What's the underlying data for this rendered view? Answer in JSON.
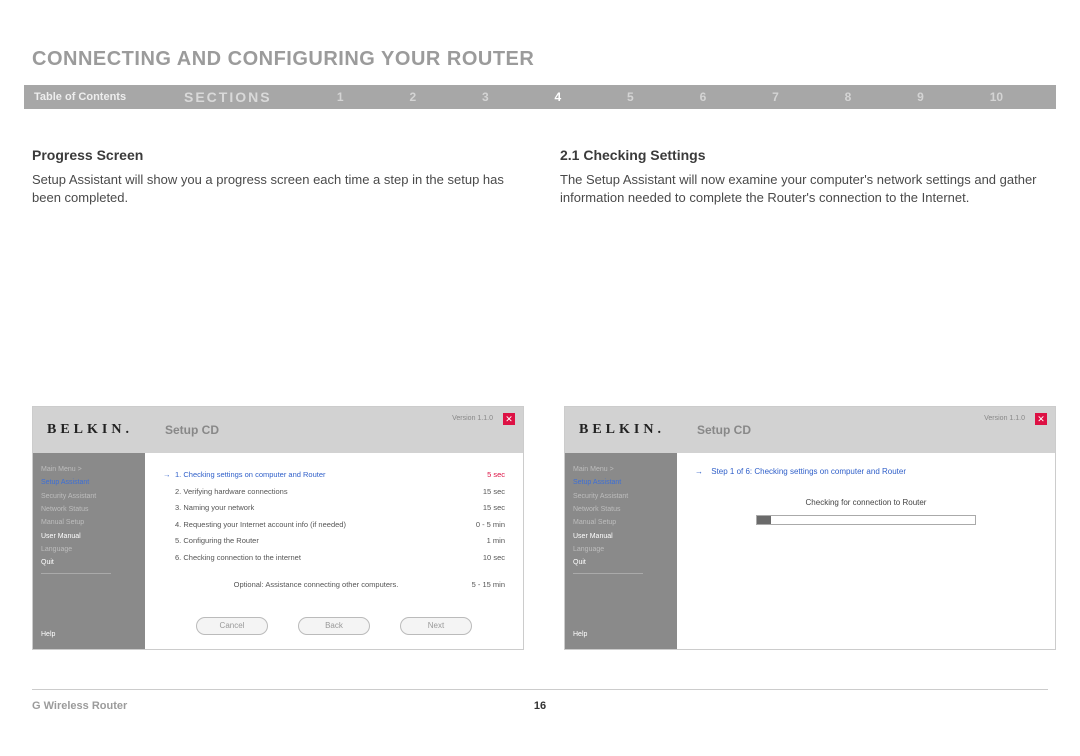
{
  "page_title": "CONNECTING AND CONFIGURING YOUR ROUTER",
  "nav": {
    "toc": "Table of Contents",
    "sections": "SECTIONS",
    "numbers": [
      "1",
      "2",
      "3",
      "4",
      "5",
      "6",
      "7",
      "8",
      "9",
      "10"
    ],
    "active": "4"
  },
  "left": {
    "heading": "Progress Screen",
    "body": "Setup Assistant will show you a progress screen each time a step in the setup has been completed."
  },
  "right": {
    "heading": "2.1 Checking Settings",
    "body": "The Setup Assistant will now examine your computer's network settings and gather information needed to complete the Router's connection to the Internet."
  },
  "shot_common": {
    "logo": "BELKIN.",
    "subtitle": "Setup CD",
    "version": "Version 1.1.0",
    "close": "✕",
    "side": {
      "main_menu": "Main Menu  >",
      "setup_assistant": "Setup Assistant",
      "security_assistant": "Security Assistant",
      "network_status": "Network Status",
      "manual_setup": "Manual Setup",
      "user_manual": "User Manual",
      "language": "Language",
      "quit": "Quit",
      "help": "Help"
    }
  },
  "shot1": {
    "steps": [
      {
        "n": "1.",
        "label": "Checking settings on computer and Router",
        "time": "5 sec",
        "active": true
      },
      {
        "n": "2.",
        "label": "Verifying hardware connections",
        "time": "15 sec",
        "active": false
      },
      {
        "n": "3.",
        "label": "Naming your network",
        "time": "15 sec",
        "active": false
      },
      {
        "n": "4.",
        "label": "Requesting your Internet account info (if needed)",
        "time": "0 - 5 min",
        "active": false
      },
      {
        "n": "5.",
        "label": "Configuring the Router",
        "time": "1 min",
        "active": false
      },
      {
        "n": "6.",
        "label": "Checking connection to the internet",
        "time": "10 sec",
        "active": false
      }
    ],
    "optional": {
      "label": "Optional: Assistance connecting other computers.",
      "time": "5 - 15 min"
    },
    "buttons": {
      "cancel": "Cancel",
      "back": "Back",
      "next": "Next"
    }
  },
  "shot2": {
    "title": "Step 1 of 6: Checking settings on computer and Router",
    "msg": "Checking for connection to Router"
  },
  "footer": {
    "product": "G Wireless Router",
    "page": "16"
  }
}
